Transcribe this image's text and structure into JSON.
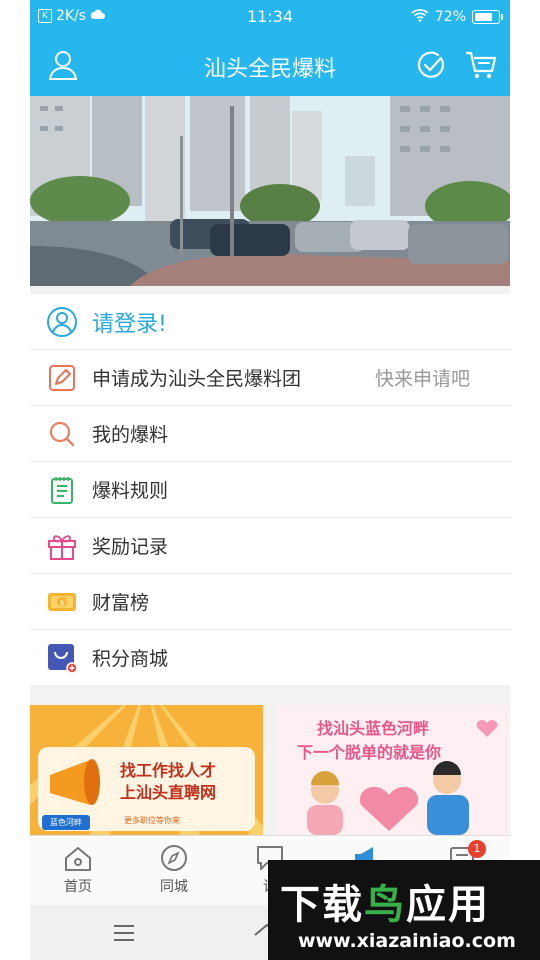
{
  "status_bar": {
    "network_speed": "2K/s",
    "time": "11:34",
    "battery": "72%"
  },
  "header": {
    "title": "汕头全民爆料"
  },
  "menu": {
    "login_label": "请登录!",
    "apply_label": "申请成为汕头全民爆料团",
    "apply_hint": "快来申请吧",
    "my_reports_label": "我的爆料",
    "rules_label": "爆料规则",
    "rewards_label": "奖励记录",
    "wealth_label": "财富榜",
    "shop_label": "积分商城"
  },
  "ads": {
    "left": {
      "headline1": "找工作找人才",
      "headline2": "上汕头直聘网",
      "tag": "蓝色河畔",
      "sub": "更多职位等你来"
    },
    "right": {
      "line1": "找汕头蓝色河畔",
      "line2": "下一个脱单的就是你"
    }
  },
  "tabs": [
    {
      "label": "首页"
    },
    {
      "label": "同城"
    },
    {
      "label": "论"
    }
  ],
  "badge_count": "1",
  "watermark": {
    "title_part1": "下载",
    "title_part2": "鸟",
    "title_part3": "应用",
    "url": "www.xiazainiao.com"
  },
  "colors": {
    "primary": "#27b7ef",
    "link": "#27a9e0"
  }
}
